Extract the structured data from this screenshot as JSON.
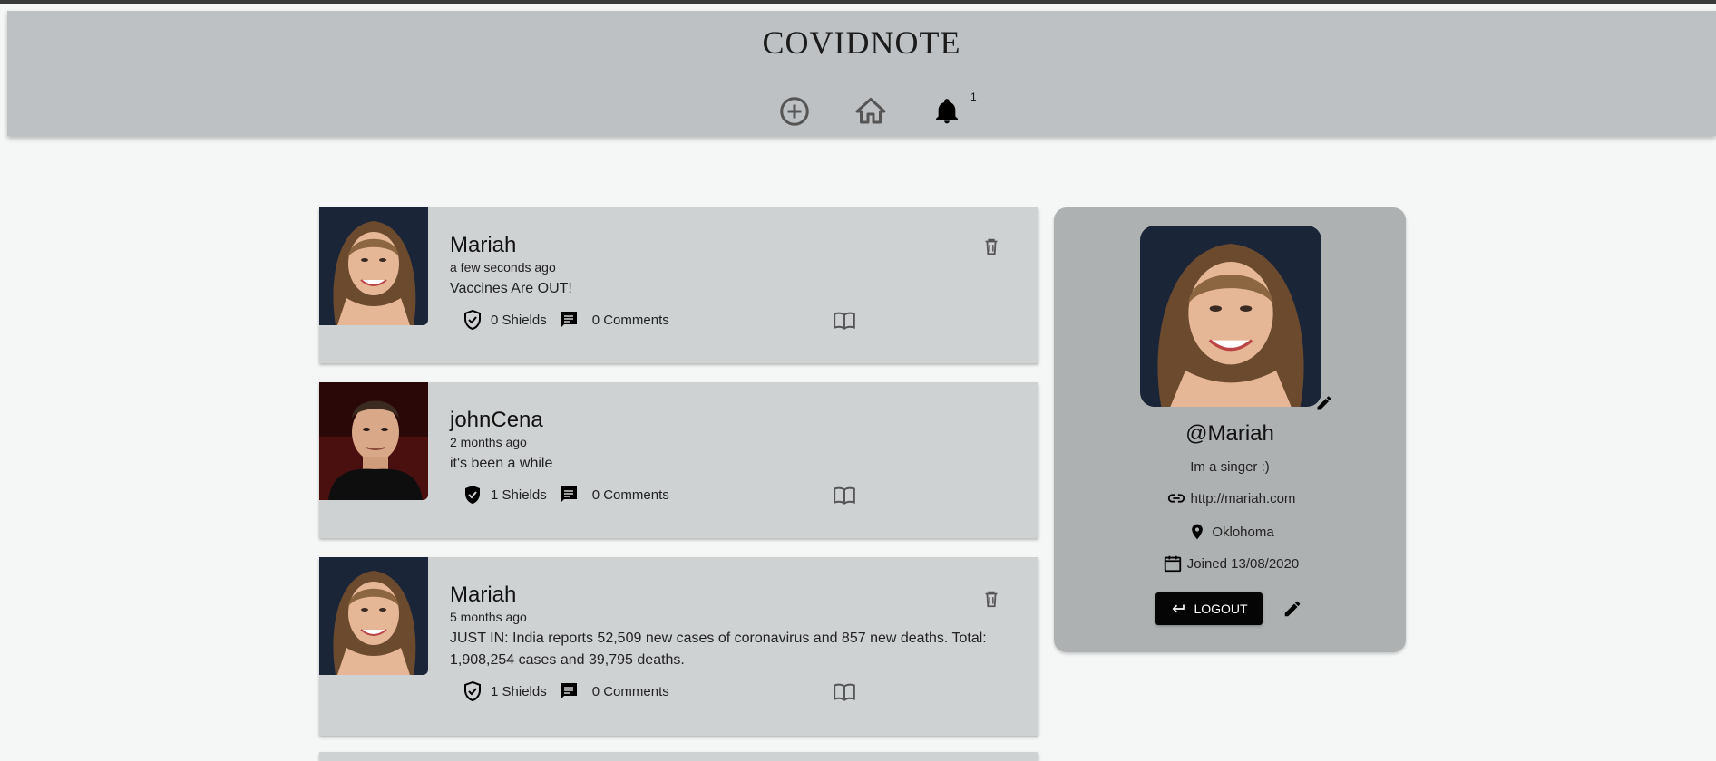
{
  "app": {
    "title": "COVIDNOTE"
  },
  "nav": {
    "notification_count": "1"
  },
  "posts": [
    {
      "user": "Mariah",
      "time": "a few seconds ago",
      "body": "Vaccines Are OUT!",
      "shields": "0 Shields",
      "comments": "0 Comments",
      "can_delete": true,
      "shield_filled": false
    },
    {
      "user": "johnCena",
      "time": "2 months ago",
      "body": "it's been a while",
      "shields": "1 Shields",
      "comments": "0 Comments",
      "can_delete": false,
      "shield_filled": true
    },
    {
      "user": "Mariah",
      "time": "5 months ago",
      "body": "JUST IN: India reports 52,509 new cases of coronavirus and 857 new deaths. Total: 1,908,254 cases and 39,795 deaths.",
      "shields": "1 Shields",
      "comments": "0 Comments",
      "can_delete": true,
      "shield_filled": false
    }
  ],
  "profile": {
    "handle": "@Mariah",
    "bio": "Im a singer :)",
    "website": "http://mariah.com",
    "location": "Oklohoma",
    "joined": "Joined 13/08/2020",
    "logout_label": "LOGOUT"
  },
  "colors": {
    "appbar": "#bdc1c4",
    "card": "#cfd2d3",
    "profile": "#aeb1b2",
    "logout": "#050505"
  }
}
